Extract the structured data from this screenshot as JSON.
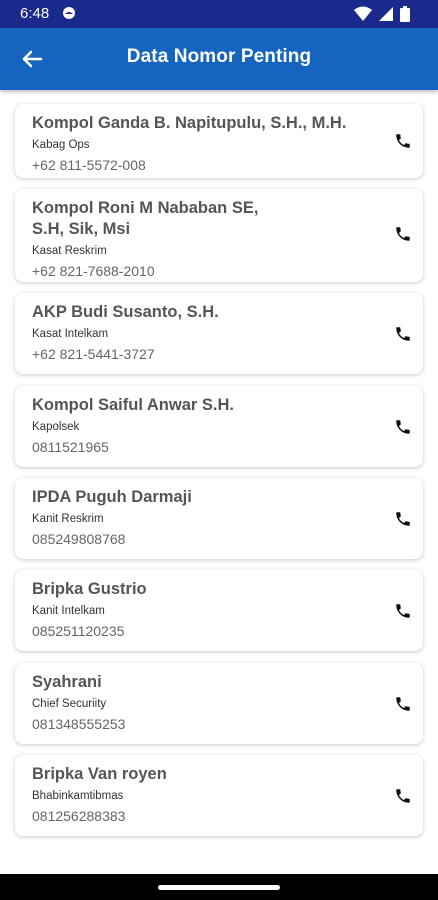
{
  "status_bar": {
    "time": "6:48"
  },
  "app_bar": {
    "title": "Data Nomor Penting"
  },
  "contacts": [
    {
      "name": "Kompol Ganda B. Napitupulu, S.H., M.H.",
      "role": "Kabag Ops",
      "phone": "+62 811-5572-008"
    },
    {
      "name": "Kompol Roni M Nababan SE, S.H, Sik, Msi",
      "role": "Kasat Reskrim",
      "phone": "+62 821-7688-2010"
    },
    {
      "name": "AKP Budi Susanto, S.H.",
      "role": "Kasat Intelkam",
      "phone": "+62 821-5441-3727"
    },
    {
      "name": "Kompol Saiful Anwar S.H.",
      "role": "Kapolsek",
      "phone": "0811521965"
    },
    {
      "name": "IPDA Puguh Darmaji",
      "role": "Kanit Reskrim",
      "phone": "085249808768"
    },
    {
      "name": "Bripka Gustrio",
      "role": "Kanit Intelkam",
      "phone": "085251120235"
    },
    {
      "name": "Syahrani",
      "role": "Chief Securiity",
      "phone": "081348555253"
    },
    {
      "name": "Bripka Van royen",
      "role": "Bhabinkamtibmas",
      "phone": "081256288383"
    }
  ],
  "colors": {
    "status_bar": "#1a2a8c",
    "app_bar": "#1565c0",
    "name_text": "#555555"
  },
  "icons": {
    "back": "arrow-left-icon",
    "call": "phone-icon"
  }
}
